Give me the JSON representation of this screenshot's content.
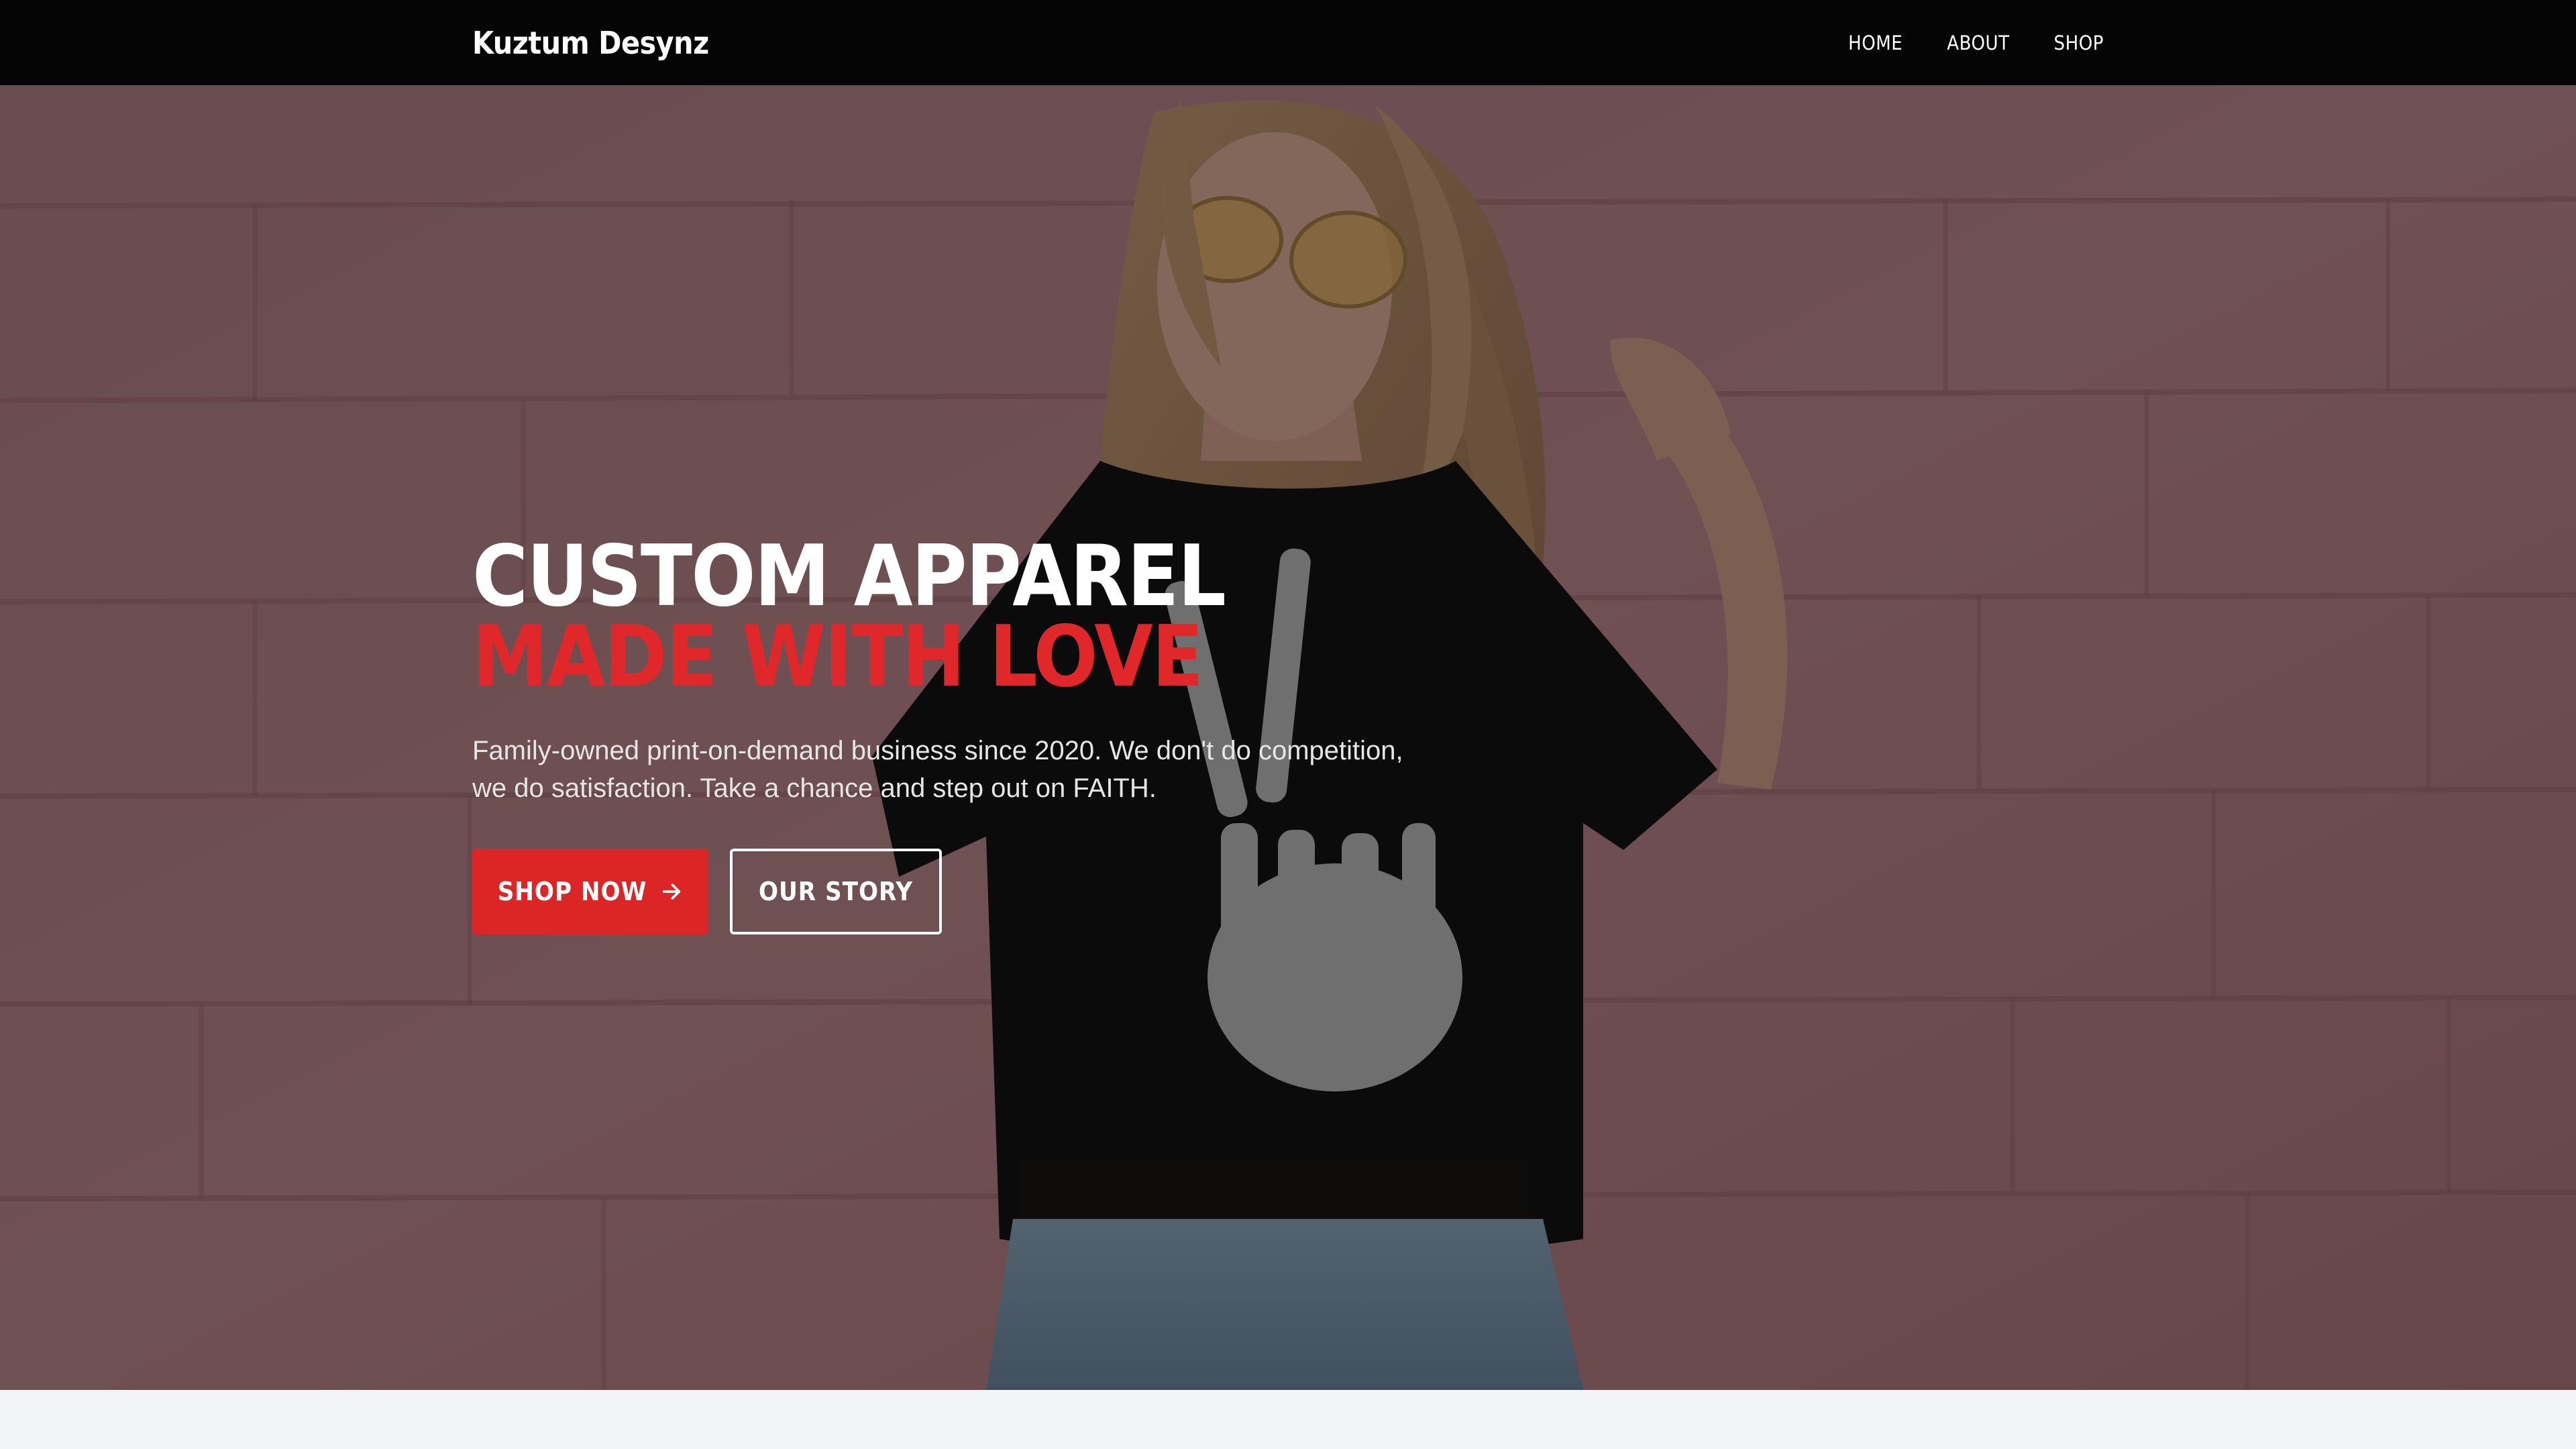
{
  "nav": {
    "brand": "Kuztum Desynz",
    "links": [
      {
        "label": "HOME"
      },
      {
        "label": "ABOUT"
      },
      {
        "label": "SHOP"
      }
    ]
  },
  "hero": {
    "headline_line1": "CUSTOM APPAREL",
    "headline_line2": "MADE WITH LOVE",
    "subtext": "Family-owned print-on-demand business since 2020. We don't do competition, we do satisfaction. Take a chance and step out on FAITH.",
    "primary_button": "SHOP NOW",
    "secondary_button": "OUR STORY",
    "background_image": "model-wearing-skeleton-peace-sign-tee"
  },
  "colors": {
    "nav_bg": "#050505",
    "accent_red": "#dc2626",
    "headline_red": "#e0282b",
    "page_bg": "#f3f4f6"
  },
  "icons": {
    "primary_button_icon": "arrow-right-icon"
  }
}
